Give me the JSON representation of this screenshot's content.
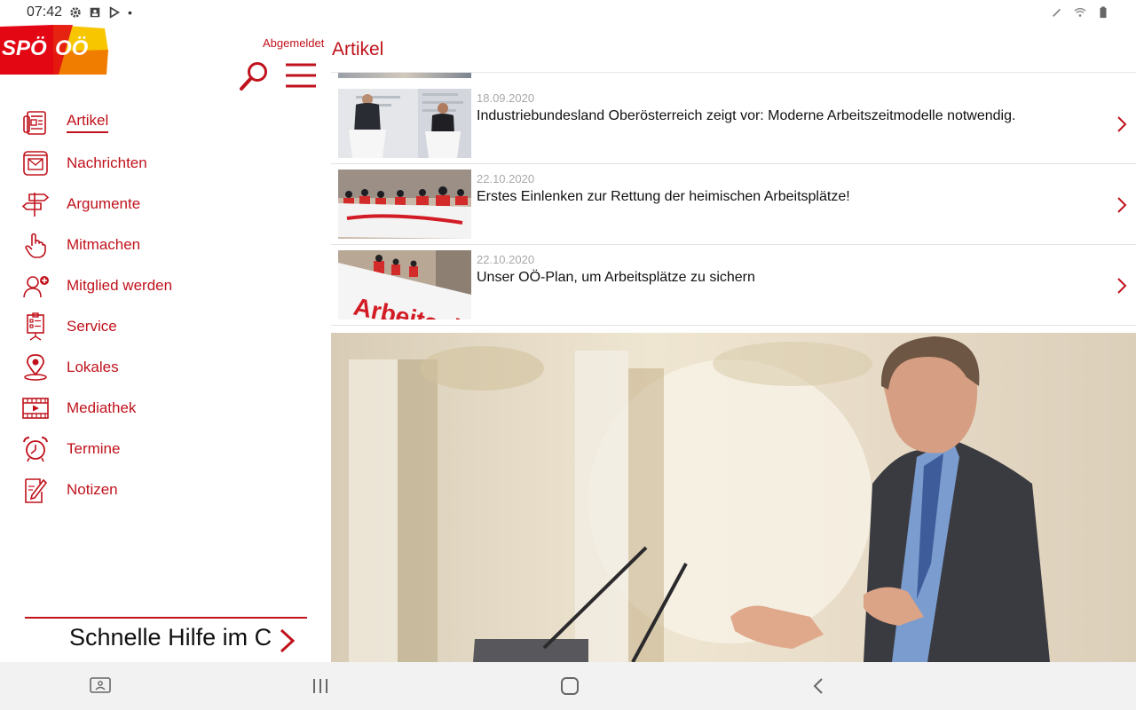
{
  "status": {
    "time": "07:42",
    "left_icons": [
      "settings-icon",
      "photo-notification-icon",
      "play-store-icon",
      "dot-icon"
    ],
    "right_icons": [
      "stylus-icon",
      "wifi-icon",
      "battery-icon"
    ]
  },
  "sidebar": {
    "logo": {
      "brand_left": "SPÖ",
      "brand_right": "OÖ"
    },
    "login_status": "Abgemeldet",
    "items": [
      {
        "label": "Artikel",
        "icon": "article-icon",
        "active": true
      },
      {
        "label": "Nachrichten",
        "icon": "envelope-icon"
      },
      {
        "label": "Argumente",
        "icon": "signpost-icon"
      },
      {
        "label": "Mitmachen",
        "icon": "hand-pointer-icon"
      },
      {
        "label": "Mitglied werden",
        "icon": "add-member-icon"
      },
      {
        "label": "Service",
        "icon": "clipboard-icon"
      },
      {
        "label": "Lokales",
        "icon": "map-pin-icon"
      },
      {
        "label": "Mediathek",
        "icon": "film-icon"
      },
      {
        "label": "Termine",
        "icon": "alarm-clock-icon"
      },
      {
        "label": "Notizen",
        "icon": "notes-icon"
      }
    ],
    "quick_help": "Schnelle Hilfe im C"
  },
  "main": {
    "title": "Artikel",
    "articles": [
      {
        "date": "18.09.2020",
        "title": "Industriebundesland Oberösterreich zeigt vor: Moderne Arbeitszeitmodelle notwendig."
      },
      {
        "date": "22.10.2020",
        "title": "Erstes Einlenken zur Rettung der heimischen Arbeitsplätze!"
      },
      {
        "date": "22.10.2020",
        "title": "Unser OÖ-Plan, um Arbeitsplätze zu sichern",
        "banner_text": "Arbeitsplätze"
      }
    ]
  },
  "colors": {
    "accent": "#c0121c",
    "logo_red": "#e30613",
    "logo_yellow": "#f7c600",
    "logo_orange": "#f07d00"
  }
}
